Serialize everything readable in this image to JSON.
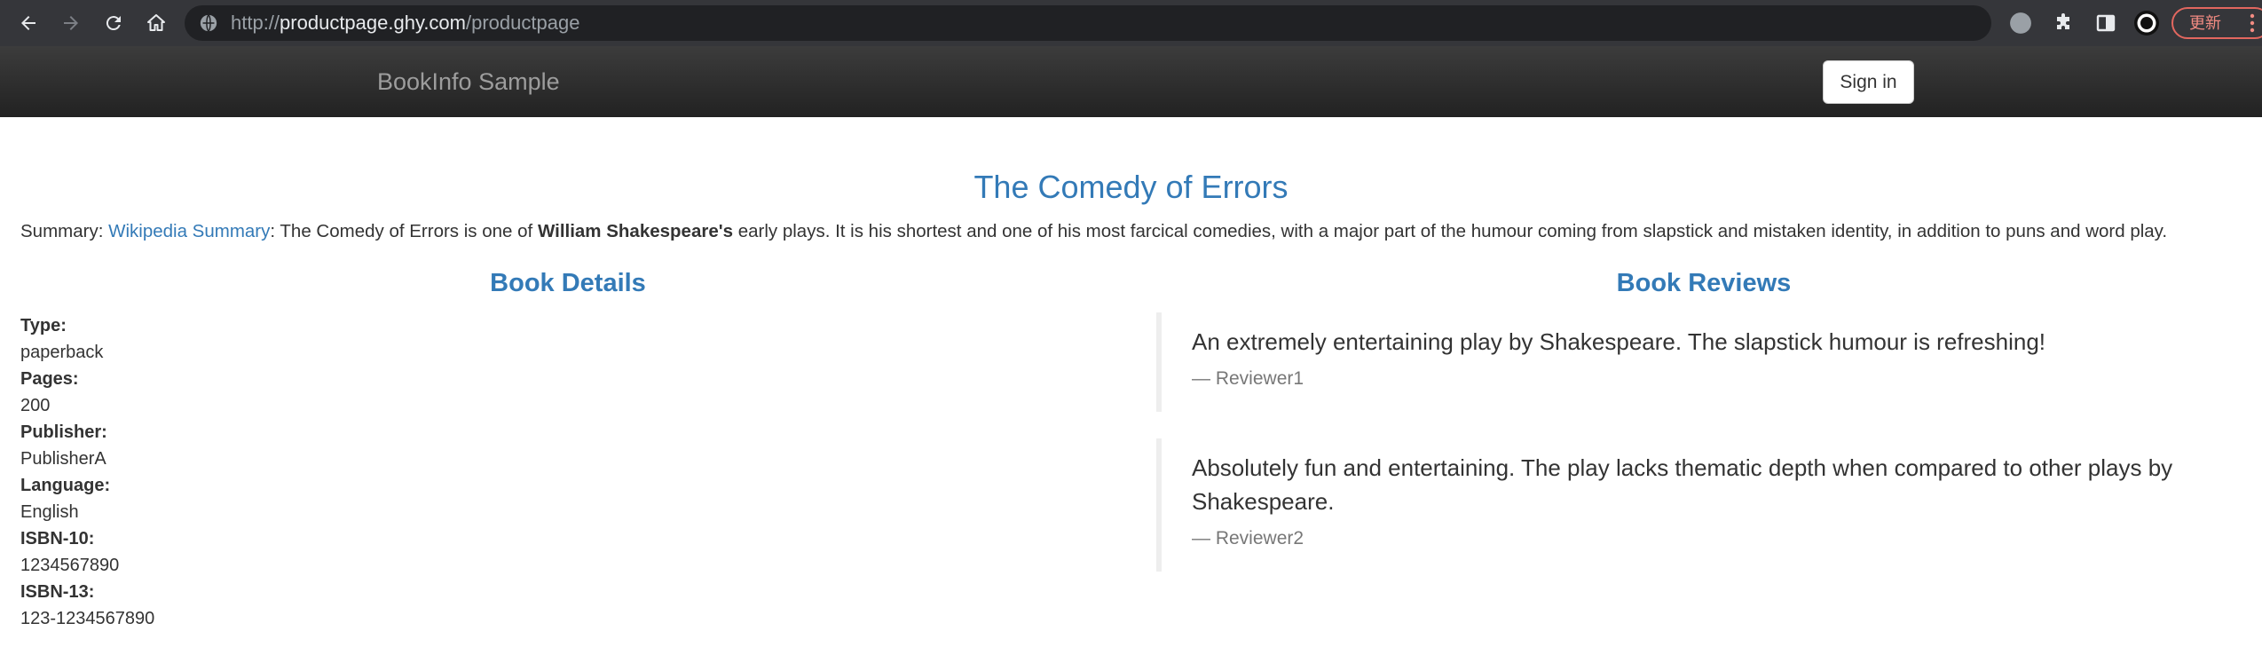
{
  "browser": {
    "url_prefix": "http://",
    "url_host": "productpage.ghy.com",
    "url_path": "/productpage",
    "update_label": "更新",
    "icons": [
      "back-arrow-icon",
      "forward-arrow-icon",
      "reload-icon",
      "home-icon",
      "site-info-icon",
      "profile-circle-icon",
      "extensions-puzzle-icon",
      "side-panel-icon",
      "avatar-icon",
      "kebab-menu-icon"
    ]
  },
  "navbar": {
    "brand": "BookInfo Sample",
    "signin_label": "Sign in"
  },
  "product": {
    "title": "The Comedy of Errors",
    "summary_prefix": "Summary: ",
    "summary_link": "Wikipedia Summary",
    "summary_mid": ": The Comedy of Errors is one of ",
    "summary_bold": "William Shakespeare's",
    "summary_rest": " early plays. It is his shortest and one of his most farcical comedies, with a major part of the humour coming from slapstick and mistaken identity, in addition to puns and word play."
  },
  "details": {
    "heading": "Book Details",
    "items": [
      {
        "label": "Type:",
        "value": "paperback"
      },
      {
        "label": "Pages:",
        "value": "200"
      },
      {
        "label": "Publisher:",
        "value": "PublisherA"
      },
      {
        "label": "Language:",
        "value": "English"
      },
      {
        "label": "ISBN-10:",
        "value": "1234567890"
      },
      {
        "label": "ISBN-13:",
        "value": "123-1234567890"
      }
    ]
  },
  "reviews": {
    "heading": "Book Reviews",
    "items": [
      {
        "text": "An extremely entertaining play by Shakespeare. The slapstick humour is refreshing!",
        "reviewer": "— Reviewer1"
      },
      {
        "text": "Absolutely fun and entertaining. The play lacks thematic depth when compared to other plays by Shakespeare.",
        "reviewer": "— Reviewer2"
      }
    ]
  },
  "colors": {
    "link": "#337ab7",
    "navbar_bg": "#222222",
    "chrome_bg": "#35363a",
    "omnibox_bg": "#202124"
  }
}
